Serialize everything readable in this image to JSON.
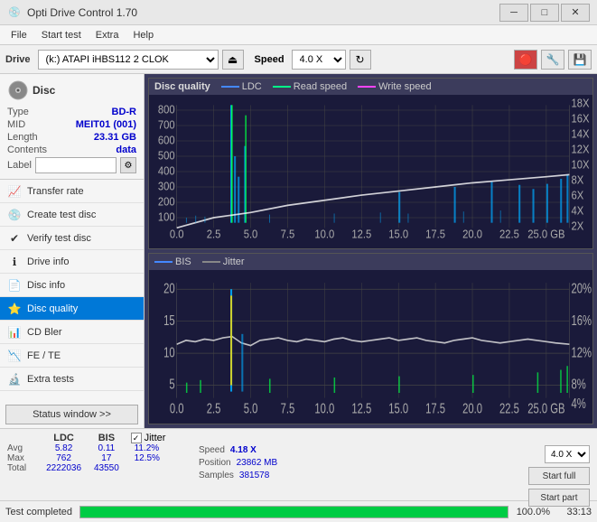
{
  "titlebar": {
    "title": "Opti Drive Control 1.70",
    "icon": "💿",
    "min_btn": "─",
    "max_btn": "□",
    "close_btn": "✕"
  },
  "menubar": {
    "items": [
      "File",
      "Start test",
      "Extra",
      "Help"
    ]
  },
  "toolbar": {
    "drive_label": "Drive",
    "drive_value": "(k:) ATAPI iHBS112  2 CLOK",
    "speed_label": "Speed",
    "speed_value": "4.0 X"
  },
  "disc": {
    "section_title": "Disc",
    "type_label": "Type",
    "type_value": "BD-R",
    "mid_label": "MID",
    "mid_value": "MEIT01 (001)",
    "length_label": "Length",
    "length_value": "23.31 GB",
    "contents_label": "Contents",
    "contents_value": "data",
    "label_label": "Label",
    "label_placeholder": ""
  },
  "nav_items": [
    {
      "id": "transfer-rate",
      "label": "Transfer rate",
      "icon": "📈",
      "active": false
    },
    {
      "id": "create-test-disc",
      "label": "Create test disc",
      "icon": "💿",
      "active": false
    },
    {
      "id": "verify-test-disc",
      "label": "Verify test disc",
      "icon": "✔",
      "active": false
    },
    {
      "id": "drive-info",
      "label": "Drive info",
      "icon": "ℹ",
      "active": false
    },
    {
      "id": "disc-info",
      "label": "Disc info",
      "icon": "📄",
      "active": false
    },
    {
      "id": "disc-quality",
      "label": "Disc quality",
      "icon": "⭐",
      "active": true
    },
    {
      "id": "cd-bler",
      "label": "CD Bler",
      "icon": "📊",
      "active": false
    },
    {
      "id": "fe-te",
      "label": "FE / TE",
      "icon": "📉",
      "active": false
    },
    {
      "id": "extra-tests",
      "label": "Extra tests",
      "icon": "🔬",
      "active": false
    }
  ],
  "status_btn": "Status window >>",
  "chart1": {
    "title": "Disc quality",
    "legend": {
      "ldc": "LDC",
      "read": "Read speed",
      "write": "Write speed"
    },
    "y_axis": [
      800,
      700,
      600,
      500,
      400,
      300,
      200,
      100
    ],
    "y_axis_right": [
      "18X",
      "16X",
      "14X",
      "12X",
      "10X",
      "8X",
      "6X",
      "4X",
      "2X"
    ],
    "x_axis": [
      "0.0",
      "2.5",
      "5.0",
      "7.5",
      "10.0",
      "12.5",
      "15.0",
      "17.5",
      "20.0",
      "22.5",
      "25.0 GB"
    ]
  },
  "chart2": {
    "legend": {
      "bis": "BIS",
      "jitter": "Jitter"
    },
    "y_axis": [
      20,
      15,
      10,
      5
    ],
    "y_axis_right": [
      "20%",
      "16%",
      "12%",
      "8%",
      "4%"
    ],
    "x_axis": [
      "0.0",
      "2.5",
      "5.0",
      "7.5",
      "10.0",
      "12.5",
      "15.0",
      "17.5",
      "20.0",
      "22.5",
      "25.0 GB"
    ]
  },
  "stats": {
    "ldc_label": "LDC",
    "bis_label": "BIS",
    "jitter_label": "Jitter",
    "jitter_checked": true,
    "speed_label": "Speed",
    "speed_value": "4.18 X",
    "speed_select": "4.0 X",
    "position_label": "Position",
    "position_value": "23862 MB",
    "samples_label": "Samples",
    "samples_value": "381578",
    "avg_label": "Avg",
    "avg_ldc": "5.82",
    "avg_bis": "0.11",
    "avg_jitter": "11.2%",
    "max_label": "Max",
    "max_ldc": "762",
    "max_bis": "17",
    "max_jitter": "12.5%",
    "total_label": "Total",
    "total_ldc": "2222036",
    "total_bis": "43550",
    "start_full_btn": "Start full",
    "start_part_btn": "Start part"
  },
  "progress": {
    "status_text": "Test completed",
    "percent": 100,
    "percent_text": "100.0%",
    "time_text": "33:13"
  }
}
